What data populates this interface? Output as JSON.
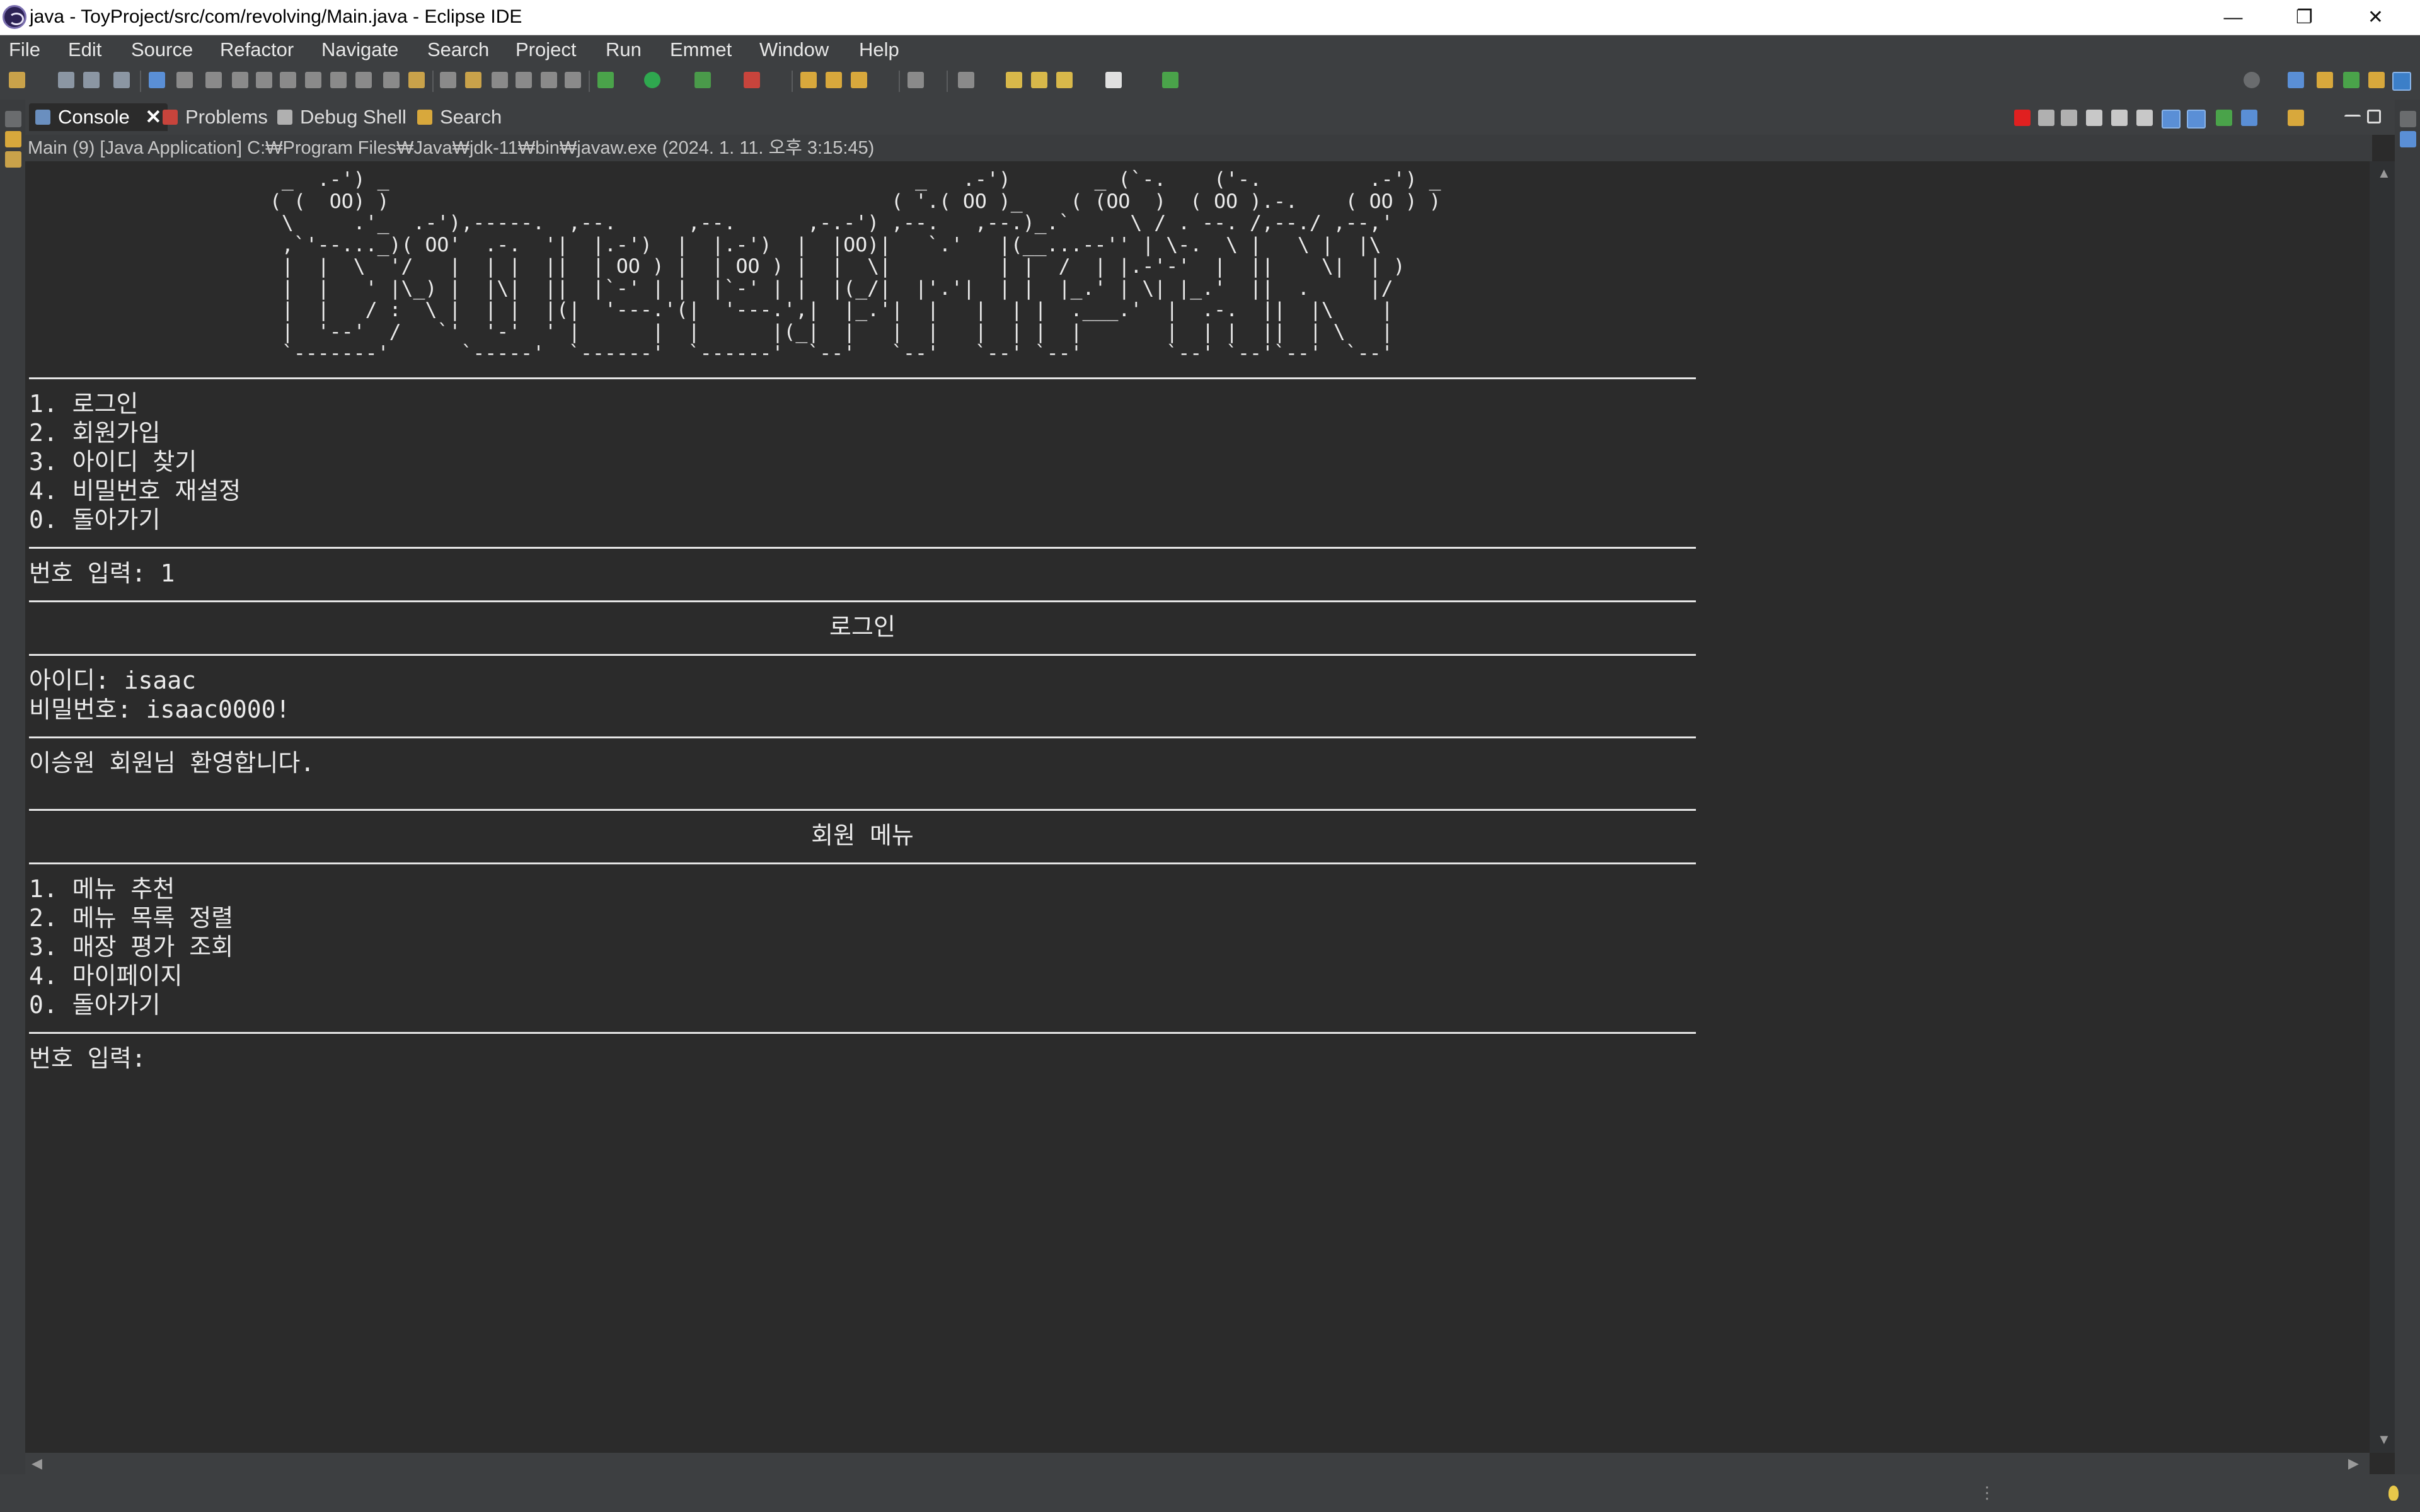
{
  "window": {
    "title": "java - ToyProject/src/com/revolving/Main.java - Eclipse IDE",
    "minimize": "—",
    "restore": "❐",
    "close": "✕"
  },
  "menu": [
    "File",
    "Edit",
    "Source",
    "Refactor",
    "Navigate",
    "Search",
    "Project",
    "Run",
    "Emmet",
    "Window",
    "Help"
  ],
  "view_tabs": {
    "console": "Console",
    "problems": "Problems",
    "debug_shell": "Debug Shell",
    "search": "Search",
    "close_glyph": "✕"
  },
  "process_info": "Main (9) [Java Application] C:₩Program Files₩Java₩jdk-11₩bin₩javaw.exe  (2024. 1. 11. 오후 3:15:45)",
  "console": {
    "ascii_art": "   _  .-') _                                            _   .-')       _ (`-.    ('-.         .-') _\n  ( (  OO) )                                          ( '.( OO )_    ( (OO  )  ( OO ).-.    ( OO ) )\n   \\     .'_  .-'),-----.  ,--.      ,--.      ,-.-') ,--.   ,--.)_.`     \\ / . --. /,--./ ,--,'\n   ,`'--..._)( OO'  .-.  '|  |.-')  |  |.-')  |  |OO)|   `.'   |(__...--'' | \\-.  \\ |   \\ |  |\\\n   |  |  \\  '/   |  | |  ||  | OO ) |  | OO ) |  |  \\|         | |  /  | |.-'-'  |  ||    \\|  | )\n   |  |   ' |\\_) |  |\\|  ||  |`-' | |  |`-' | |  |(_/|  |'.'|  | |  |_.' | \\| |_.'  ||  .     |/\n   |  |   / :  \\ |  | |  |(|  '---.'(|  '---.',|  |_.'|  |   |  | |  .___.'  |  .-.  ||  |\\    |\n   |  '--'  /   `'  '-'  ' |      |  |      |(_|  |   |  |   |  | |  |       |  | |  ||  | \\   |\n   `-------'      `-----'  `------'  `------'  `--'   `--'   `--' `--'       `--' `--'`--'  `--'",
    "main_menu": [
      "1. 로그인",
      "2. 회원가입",
      "3. 아이디 찾기",
      "4. 비밀번호 재설정",
      "0. 돌아가기"
    ],
    "input_prompt_1": "번호 입력: 1",
    "login_header": "로그인",
    "id_line": "아이디: isaac",
    "pw_line": "비밀번호: isaac0000!",
    "welcome": "이승원 회원님 환영합니다.",
    "member_menu_header": "회원 메뉴",
    "member_menu": [
      "1. 메뉴 추천",
      "2. 메뉴 목록 정렬",
      "3. 매장 평가 조회",
      "4. 마이페이지",
      "0. 돌아가기"
    ],
    "input_prompt_2": "번호 입력:"
  },
  "colors": {
    "background": "#2b2b2b",
    "chrome": "#3d3f41",
    "text": "#ebebeb",
    "terminate_red": "#e02020"
  },
  "icons": [
    "app-icon",
    "console-icon",
    "problems-icon",
    "debug-shell-icon",
    "search-icon",
    "terminate-icon",
    "remove-launch-icon",
    "remove-all-icon",
    "scroll-lock-icon",
    "word-wrap-icon",
    "pin-icon",
    "display-console-icon",
    "open-console-icon",
    "minimize-icon",
    "maximize-icon"
  ]
}
